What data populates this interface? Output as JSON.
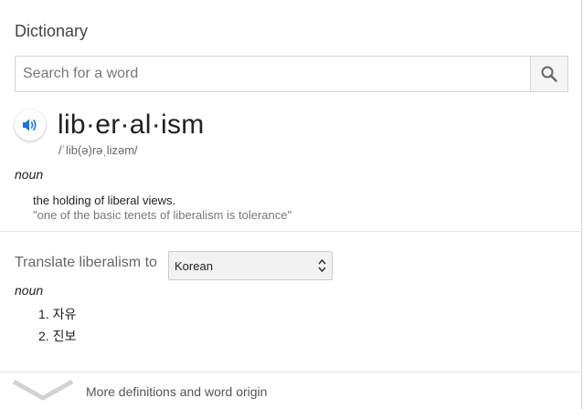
{
  "panel": {
    "title": "Dictionary",
    "search": {
      "placeholder": "Search for a word",
      "value": "",
      "icon": "search-icon"
    }
  },
  "entry": {
    "speaker_icon": "speaker-icon",
    "accent_color": "#1a73e8",
    "headword": "lib·er·al·ism",
    "phonetic": "/ˈlib(ə)rəˌlizəm/",
    "part_of_speech": "noun",
    "definition": "the holding of liberal views.",
    "example": "\"one of the basic tenets of liberalism is tolerance\""
  },
  "translate": {
    "label": "Translate liberalism to",
    "language": "Korean",
    "part_of_speech": "noun",
    "items": [
      {
        "num": "1.",
        "text": "자유"
      },
      {
        "num": "2.",
        "text": "진보"
      }
    ]
  },
  "footer": {
    "more_label": "More definitions and word origin",
    "icon": "chevron-down-icon"
  }
}
